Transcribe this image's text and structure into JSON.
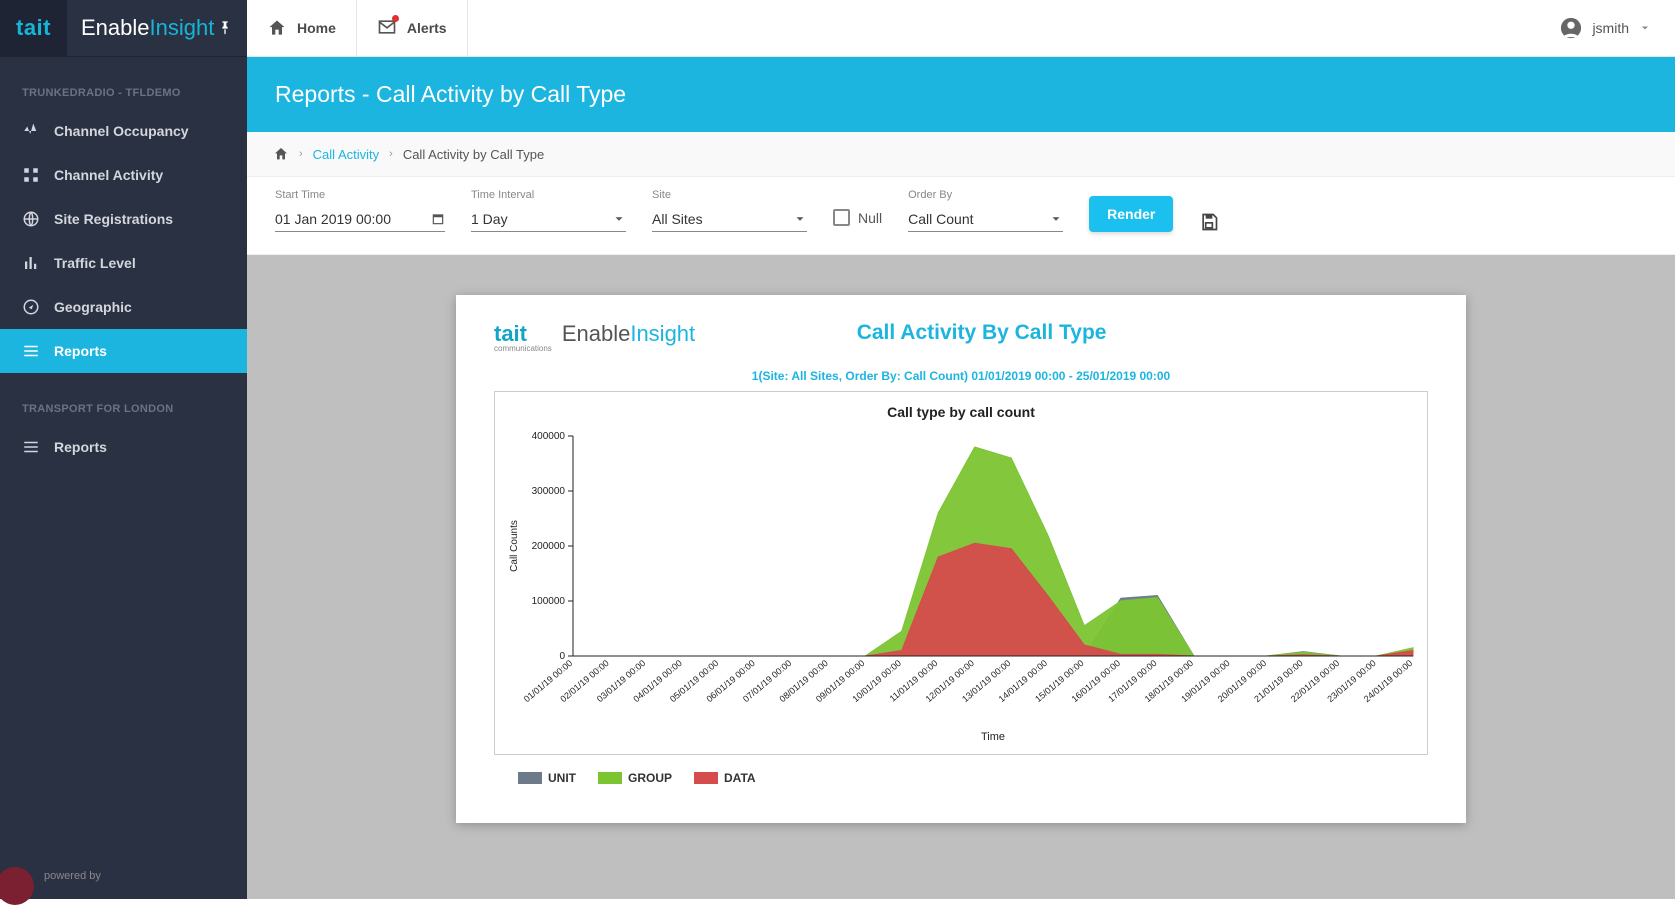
{
  "brand": {
    "company": "tait",
    "company_sub": "communications",
    "product_a": "Enable",
    "product_b": "Insight"
  },
  "topbar": {
    "home": "Home",
    "alerts": "Alerts",
    "user": "jsmith"
  },
  "sidebar": {
    "section1": "TRUNKEDRADIO - TFLDEMO",
    "items1": [
      {
        "label": "Channel Occupancy"
      },
      {
        "label": "Channel Activity"
      },
      {
        "label": "Site Registrations"
      },
      {
        "label": "Traffic Level"
      },
      {
        "label": "Geographic"
      },
      {
        "label": "Reports"
      }
    ],
    "section2": "TRANSPORT FOR LONDON",
    "items2": [
      {
        "label": "Reports"
      }
    ],
    "footer": "powered by"
  },
  "page": {
    "title": "Reports - Call Activity by Call Type",
    "breadcrumb_link": "Call Activity",
    "breadcrumb_current": "Call Activity by Call Type"
  },
  "filters": {
    "start_time_label": "Start Time",
    "start_time_value": "01 Jan 2019 00:00",
    "time_interval_label": "Time Interval",
    "time_interval_value": "1 Day",
    "site_label": "Site",
    "site_value": "All Sites",
    "null_label": "Null",
    "orderby_label": "Order By",
    "orderby_value": "Call Count",
    "render": "Render"
  },
  "report": {
    "title": "Call Activity By Call Type",
    "subtitle": "1(Site: All Sites, Order By: Call Count) 01/01/2019 00:00 - 25/01/2019 00:00",
    "chart_title": "Call type by call count",
    "xlabel": "Time",
    "ylabel": "Call Counts",
    "legend": [
      "UNIT",
      "GROUP",
      "DATA"
    ]
  },
  "chart_data": {
    "type": "area",
    "xlabel": "Time",
    "ylabel": "Call Counts",
    "title": "Call type by call count",
    "ylim": [
      0,
      400000
    ],
    "yticks": [
      0,
      100000,
      200000,
      300000,
      400000
    ],
    "categories": [
      "01/01/19 00:00",
      "02/01/19 00:00",
      "03/01/19 00:00",
      "04/01/19 00:00",
      "05/01/19 00:00",
      "06/01/19 00:00",
      "07/01/19 00:00",
      "08/01/19 00:00",
      "09/01/19 00:00",
      "10/01/19 00:00",
      "11/01/19 00:00",
      "12/01/19 00:00",
      "13/01/19 00:00",
      "14/01/19 00:00",
      "15/01/19 00:00",
      "16/01/19 00:00",
      "17/01/19 00:00",
      "18/01/19 00:00",
      "19/01/19 00:00",
      "20/01/19 00:00",
      "21/01/19 00:00",
      "22/01/19 00:00",
      "23/01/19 00:00",
      "24/01/19 00:00"
    ],
    "series": [
      {
        "name": "UNIT",
        "color": "#6c7a89",
        "values": [
          0,
          0,
          0,
          0,
          0,
          0,
          0,
          0,
          0,
          0,
          0,
          0,
          0,
          0,
          0,
          105000,
          110000,
          0,
          0,
          0,
          8000,
          0,
          0,
          0
        ]
      },
      {
        "name": "GROUP",
        "color": "#7cc532",
        "values": [
          0,
          0,
          0,
          0,
          0,
          0,
          0,
          0,
          0,
          45000,
          260000,
          380000,
          360000,
          220000,
          55000,
          100000,
          106000,
          0,
          0,
          0,
          7000,
          0,
          0,
          15000
        ]
      },
      {
        "name": "DATA",
        "color": "#d44c4c",
        "values": [
          0,
          0,
          0,
          0,
          0,
          0,
          0,
          0,
          0,
          10000,
          180000,
          205000,
          195000,
          110000,
          20000,
          3000,
          3000,
          0,
          0,
          0,
          2000,
          0,
          0,
          10000
        ]
      }
    ]
  }
}
